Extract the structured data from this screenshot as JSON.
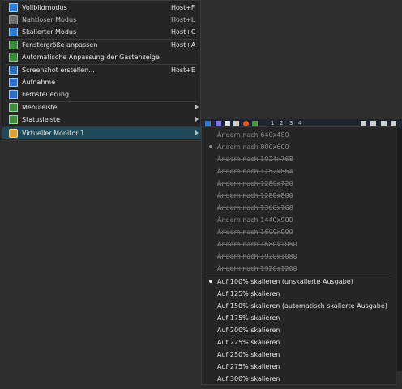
{
  "view_menu": {
    "items": [
      {
        "label": "Vollbildmodus",
        "shortcut": "Host+F",
        "icon": "fullscreen-icon"
      },
      {
        "label": "Nahtloser Modus",
        "shortcut": "Host+L",
        "icon": "seamless-icon"
      },
      {
        "label": "Skalierter Modus",
        "shortcut": "Host+C",
        "icon": "scaled-icon"
      },
      {
        "label": "Fenstergröße anpassen",
        "shortcut": "Host+A",
        "icon": "resize-icon"
      },
      {
        "label": "Automatische Anpassung der Gastanzeige",
        "shortcut": "",
        "icon": "auto-resize-icon"
      },
      {
        "label": "Screenshot erstellen...",
        "shortcut": "Host+E",
        "icon": "screenshot-icon"
      },
      {
        "label": "Aufnahme",
        "shortcut": "",
        "icon": "record-icon"
      },
      {
        "label": "Fernsteuerung",
        "shortcut": "",
        "icon": "remote-display-icon"
      },
      {
        "label": "Menüleiste",
        "shortcut": "",
        "icon": "menubar-icon"
      },
      {
        "label": "Statusleiste",
        "shortcut": "",
        "icon": "statusbar-icon"
      },
      {
        "label": "Virtueller Monitor 1",
        "shortcut": "",
        "icon": "virtual-monitor-icon"
      }
    ]
  },
  "toolbar": {
    "numbers": [
      "1",
      "2",
      "3",
      "4"
    ]
  },
  "submenu": {
    "resize_items": [
      "Ändern nach 640x480",
      "Ändern nach 800x600",
      "Ändern nach 1024x768",
      "Ändern nach 1152x864",
      "Ändern nach 1280x720",
      "Ändern nach 1280x800",
      "Ändern nach 1366x768",
      "Ändern nach 1440x900",
      "Ändern nach 1600x900",
      "Ändern nach 1680x1050",
      "Ändern nach 1920x1080",
      "Ändern nach 1920x1200"
    ],
    "scale_items": [
      "Auf 100% skalieren (unskalierte Ausgabe)",
      "Auf 125% skalieren",
      "Auf 150% skalieren (automatisch skalierte Ausgabe)",
      "Auf 175% skalieren",
      "Auf 200% skalieren",
      "Auf 225% skalieren",
      "Auf 250% skalieren",
      "Auf 275% skalieren",
      "Auf 300% skalieren"
    ]
  },
  "colors": {
    "menu_bg": "#252525",
    "highlight": "#1e4a5c",
    "text": "#e4e4e4",
    "disabled_text": "#8a8a8a"
  }
}
